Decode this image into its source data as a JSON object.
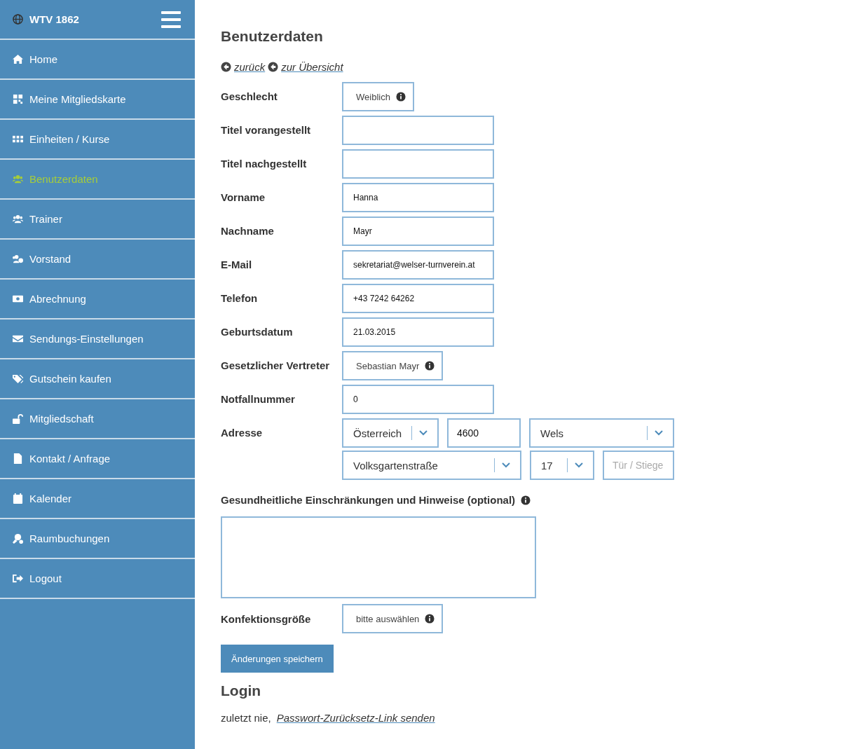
{
  "sidebar": {
    "brand": "WTV 1862",
    "items": [
      {
        "label": "Home",
        "selected": false
      },
      {
        "label": "Meine Mitgliedskarte",
        "selected": false
      },
      {
        "label": "Einheiten / Kurse",
        "selected": false
      },
      {
        "label": "Benutzerdaten",
        "selected": true
      },
      {
        "label": "Trainer",
        "selected": false
      },
      {
        "label": "Vorstand",
        "selected": false
      },
      {
        "label": "Abrechnung",
        "selected": false
      },
      {
        "label": "Sendungs-Einstellungen",
        "selected": false
      },
      {
        "label": "Gutschein kaufen",
        "selected": false
      },
      {
        "label": "Mitgliedschaft",
        "selected": false
      },
      {
        "label": "Kontakt / Anfrage",
        "selected": false
      },
      {
        "label": "Kalender",
        "selected": false
      },
      {
        "label": "Raumbuchungen",
        "selected": false
      },
      {
        "label": "Logout",
        "selected": false
      }
    ]
  },
  "page_title": "Benutzerdaten",
  "nav_links": [
    {
      "label": "zurück"
    },
    {
      "label": "zur Übersicht"
    }
  ],
  "fields": [
    {
      "label": "Geschlecht",
      "kind": "choice",
      "value": "Weiblich"
    },
    {
      "label": "Titel vorangestellt",
      "kind": "text"
    },
    {
      "label": "Titel nachgestellt",
      "kind": "text"
    },
    {
      "label": "Vorname",
      "kind": "text",
      "value": "Hanna"
    },
    {
      "label": "Nachname",
      "kind": "text",
      "value": "Mayr"
    },
    {
      "label": "E-Mail",
      "kind": "text",
      "value": "sekretariat@welser-turnverein.at"
    },
    {
      "label": "Telefon",
      "kind": "text",
      "value": "+43 7242 64262"
    },
    {
      "label": "Geburtsdatum",
      "kind": "text",
      "value": "21.03.2015"
    },
    {
      "label": "Gesetzlicher Vertreter",
      "kind": "choice",
      "value": "Sebastian Mayr"
    },
    {
      "label": "Notfallnummer",
      "kind": "text",
      "value": "0"
    },
    {
      "label": "Adresse",
      "kind": "address",
      "parts": [
        {
          "kind": "select",
          "value": "Österreich"
        },
        {
          "kind": "text",
          "value": "4600"
        },
        {
          "kind": "select",
          "value": "Wels"
        },
        {
          "kind": "select",
          "value": "Volksgartenstraße"
        },
        {
          "kind": "select",
          "value": "17"
        },
        {
          "kind": "text",
          "placeholder": "Tür / Stiege"
        }
      ]
    }
  ],
  "health": {
    "label": "Gesundheitliche Einschränkungen und Hinweise (optional)"
  },
  "size_field": {
    "label": "Konfektionsgröße",
    "value": "bitte auswählen"
  },
  "save_button": "Änderungen speichern",
  "login": {
    "title": "Login",
    "text": "zuletzt nie,",
    "link": "Passwort-Zurücksetz-Link senden"
  }
}
